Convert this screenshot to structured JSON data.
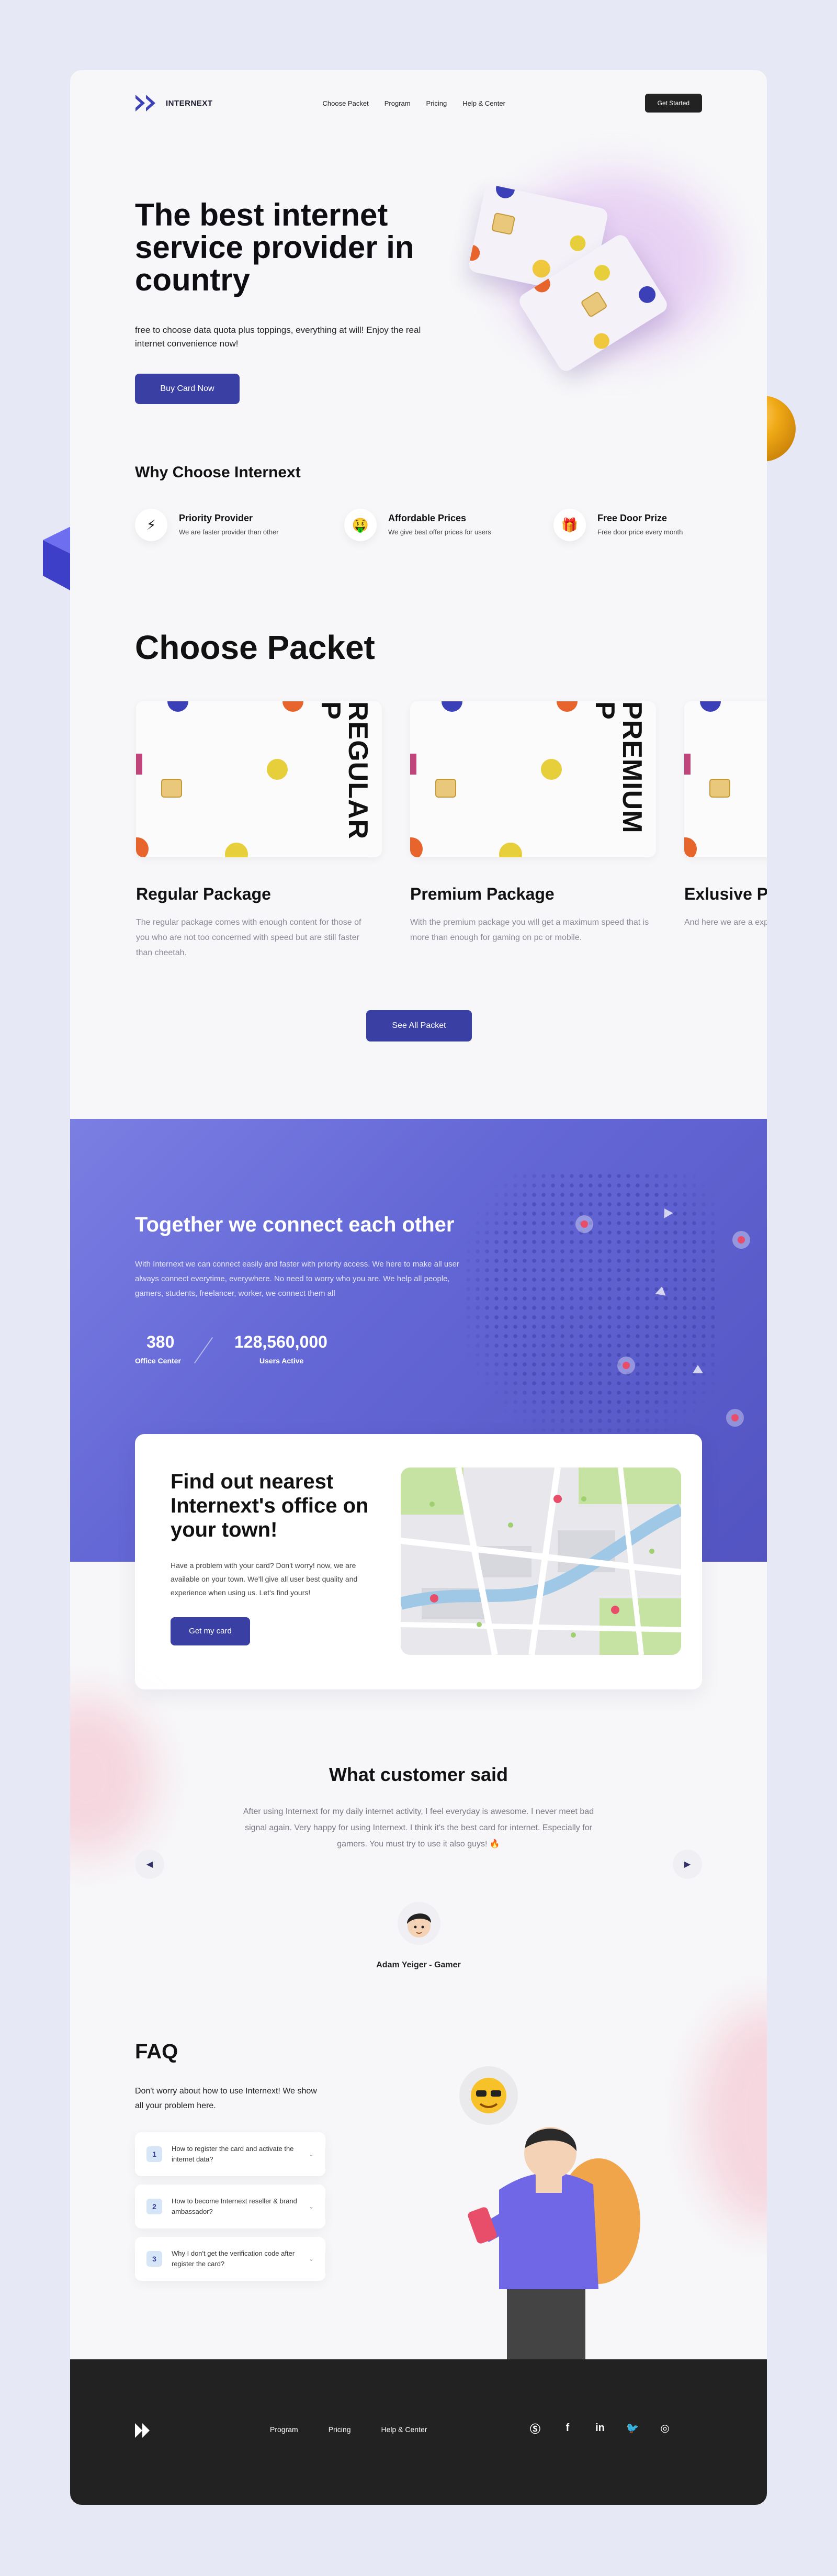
{
  "brand": {
    "name": "INTERNEXT"
  },
  "nav": {
    "items": [
      "Choose Packet",
      "Program",
      "Pricing",
      "Help & Center"
    ],
    "cta": "Get Started"
  },
  "hero": {
    "title": "The best internet service provider in country",
    "subtitle": "free to choose data quota plus toppings, everything at will! Enjoy the real internet convenience now!",
    "button": "Buy Card Now"
  },
  "why": {
    "title": "Why Choose Internext",
    "features": [
      {
        "icon": "lightning-icon",
        "title": "Priority Provider",
        "text": "We are faster provider than other"
      },
      {
        "icon": "money-face-icon",
        "title": "Affordable Prices",
        "text": "We give best offer prices for users"
      },
      {
        "icon": "gift-icon",
        "title": "Free Door Prize",
        "text": "Free door price every month"
      }
    ]
  },
  "packets": {
    "title": "Choose Packet",
    "items": [
      {
        "card_label": "REGULAR P",
        "name": "Regular Package",
        "desc": "The regular package comes with enough content for those of you who are not too concerned with speed but are still faster than cheetah."
      },
      {
        "card_label": "PREMIUM P",
        "name": "Premium Package",
        "desc": "With the premium package you will get a maximum speed that is more than enough for gaming on pc or mobile."
      },
      {
        "card_label": "",
        "name": "Exlusive Pa",
        "desc": "And here we are a explore the world w about the world an"
      }
    ],
    "button": "See All Packet"
  },
  "together": {
    "title": "Together we connect each other",
    "text": "With Internext we can connect easily and faster with priority access. We here to make all user always connect everytime, everywhere. No need to worry who you are. We help all people, gamers, students, freelancer, worker, we connect them all",
    "stats": [
      {
        "value": "380",
        "label": "Office Center"
      },
      {
        "value": "128,560,000",
        "label": "Users Active"
      }
    ]
  },
  "office": {
    "title": "Find out nearest Internext's office on your town!",
    "text": "Have a problem with your card? Don't worry! now, we are available on your town. We'll give all user best quality and experience when using us. Let's find yours!",
    "button": "Get my card"
  },
  "testimonial": {
    "title": "What customer said",
    "quote": "After using Internext for my daily internet activity, I feel everyday is awesome. I never meet bad signal again. Very happy for using Internext. I think it's the best card for internet. Especially for gamers. You must try to use it also guys! 🔥",
    "author": "Adam Yeiger - Gamer"
  },
  "faq": {
    "title": "FAQ",
    "subtitle": "Don't worry about how to use Internext! We show all your problem here.",
    "items": [
      {
        "num": "1",
        "q": "How to register the card and activate the internet data?"
      },
      {
        "num": "2",
        "q": "How to become Internext reseller & brand ambassador?"
      },
      {
        "num": "3",
        "q": "Why I don't get the verification code after register the card?"
      }
    ]
  },
  "footer": {
    "items": [
      "Program",
      "Pricing",
      "Help & Center"
    ],
    "social": [
      "skype-icon",
      "facebook-icon",
      "linkedin-icon",
      "twitter-icon",
      "instagram-icon"
    ]
  },
  "colors": {
    "primary": "#3a3fa4",
    "accent_purple": "#6468d6",
    "dark": "#222222",
    "orange": "#f0a916"
  }
}
